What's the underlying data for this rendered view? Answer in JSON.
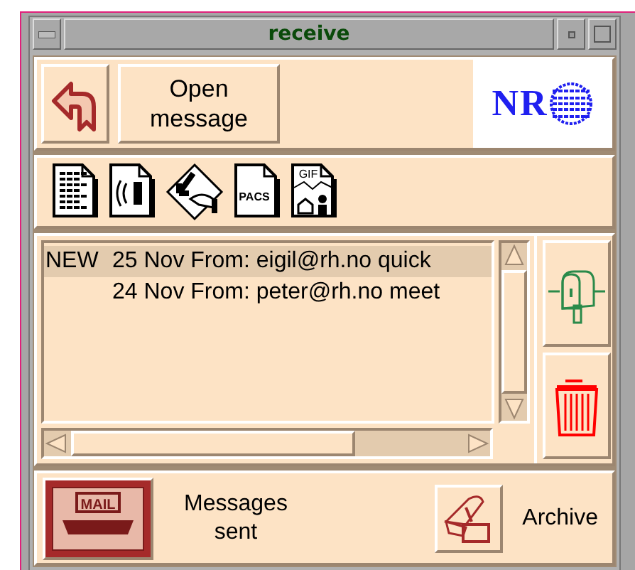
{
  "window": {
    "title": "receive"
  },
  "toolbar": {
    "open_button": {
      "label": "Open message"
    },
    "logo": {
      "text": "NR"
    }
  },
  "attachment_icons": [
    {
      "kind": "text"
    },
    {
      "kind": "sound"
    },
    {
      "kind": "import"
    },
    {
      "kind": "pacs",
      "label": "PACS"
    },
    {
      "kind": "gif",
      "label": "GIF"
    }
  ],
  "messages": [
    {
      "flag": "NEW",
      "text": "25 Nov From: eigil@rh.no quick",
      "selected": true
    },
    {
      "text": "24 Nov From: peter@rh.no meet",
      "selected": false
    }
  ],
  "bottom": {
    "mail_button": {
      "label": "MAIL"
    },
    "sent_label": "Messages sent",
    "archive_label": "Archive"
  }
}
